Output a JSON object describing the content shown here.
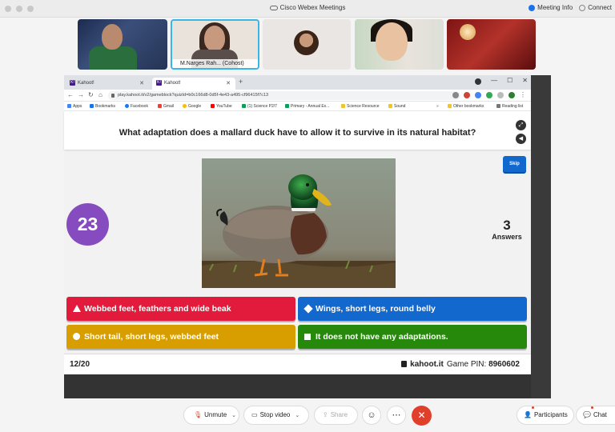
{
  "webex": {
    "title": "Cisco Webex Meetings",
    "meeting_info": "Meeting Info",
    "connect": "Connect"
  },
  "participants": {
    "cohost_name": "M.Narges Rah...",
    "cohost_tag": "(Cohost)"
  },
  "browser": {
    "tabs": [
      "Kahoot!",
      "Kahoot!"
    ],
    "url": "play.kahoot.it/v2/gameblock?quizId=b0c166d8-0d5f-4e43-a495-cf96415f7c13",
    "bookmarks": [
      "Apps",
      "Bookmarks",
      "Facebook",
      "Gmail",
      "Google",
      "YouTube",
      "(1) Science P2/7",
      "Primary - Annual Ex...",
      "Science Resource",
      "Sound",
      "Other bookmarks",
      "Reading list"
    ]
  },
  "kahoot": {
    "question": "What adaptation does a mallard duck have to allow it to survive in its natural habitat?",
    "skip_label": "Skip",
    "timer": "23",
    "answers_count": "3",
    "answers_label": "Answers",
    "answers": [
      {
        "text": "Webbed feet, feathers and wide beak",
        "shape": "triangle",
        "color": "#e21b3c"
      },
      {
        "text": "Wings, short legs, round belly",
        "shape": "diamond",
        "color": "#1368ce"
      },
      {
        "text": "Short tail, short legs, webbed feet",
        "shape": "circle",
        "color": "#d89e00"
      },
      {
        "text": "It does not have any adaptations.",
        "shape": "square",
        "color": "#26890c"
      }
    ],
    "progress": "12/20",
    "domain": "kahoot.it",
    "pin_label": "Game PIN:",
    "pin": "8960602"
  },
  "controls": {
    "unmute": "Unmute",
    "stop_video": "Stop video",
    "share": "Share",
    "participants": "Participants",
    "chat": "Chat"
  },
  "colors": {
    "kahoot_purple": "#864cbf",
    "webex_end": "#e0402b",
    "active_speaker": "#38b6e8"
  }
}
